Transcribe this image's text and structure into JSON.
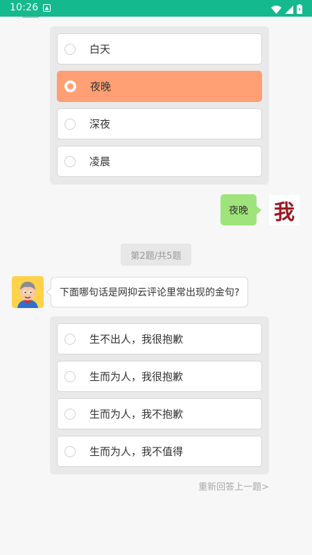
{
  "status_bar": {
    "time": "10:26",
    "icons": [
      "app-notification-icon",
      "wifi-icon",
      "signal-icon",
      "battery-icon"
    ]
  },
  "previous_question": {
    "options": [
      {
        "label": "白天",
        "selected": false
      },
      {
        "label": "夜晚",
        "selected": true
      },
      {
        "label": "深夜",
        "selected": false
      },
      {
        "label": "凌晨",
        "selected": false
      }
    ]
  },
  "user_reply": {
    "text": "夜晚",
    "avatar_text": "我"
  },
  "progress": {
    "text": "第2题/共5题"
  },
  "current_question": {
    "prompt": "下面哪句话是网抑云评论里常出现的金句?",
    "options": [
      {
        "label": "生不出人，我很抱歉",
        "selected": false
      },
      {
        "label": "生而为人，我很抱歉",
        "selected": false
      },
      {
        "label": "生而为人，我不抱歉",
        "selected": false
      },
      {
        "label": "生而为人，我不值得",
        "selected": false
      }
    ]
  },
  "redo_link": "重新回答上一题>",
  "colors": {
    "status_bar": "#14b98e",
    "selected_option": "#ff9f73",
    "user_bubble": "#9fe47b",
    "avatar_text": "#9b1a23"
  }
}
